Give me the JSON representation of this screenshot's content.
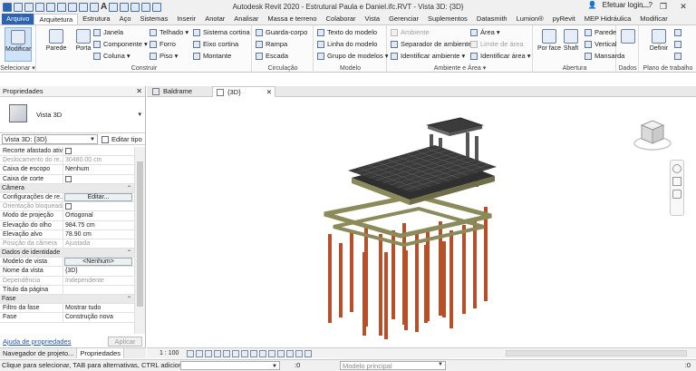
{
  "window": {
    "title": "Autodesk Revit 2020 - Estrutural Paula e Daniel.ifc.RVT - Vista 3D: {3D}",
    "login": "Efetuar login",
    "minimize": "—",
    "restore": "❐",
    "close": "✕"
  },
  "tabs": [
    "Arquivo",
    "Arquitetura",
    "Estrutura",
    "Aço",
    "Sistemas",
    "Inserir",
    "Anotar",
    "Analisar",
    "Massa e terreno",
    "Colaborar",
    "Vista",
    "Gerenciar",
    "Suplementos",
    "Datasmith",
    "Lumion®",
    "pyRevit",
    "MEP Hidráulica",
    "Modificar"
  ],
  "ribbon": {
    "selecionar": {
      "modificar": "Modificar",
      "label": "Selecionar ▾"
    },
    "construir": {
      "label": "Construir",
      "parede": "Parede",
      "porta": "Porta",
      "janela": "Janela",
      "componente": "Componente",
      "coluna": "Coluna",
      "telhado": "Telhado",
      "forro": "Forro",
      "piso": "Piso",
      "sistema_cortina": "Sistema cortina",
      "eixo_cortina": "Eixo cortina",
      "montante": "Montante"
    },
    "circulacao": {
      "label": "Circulação",
      "guarda_corpo": "Guarda-corpo",
      "rampa": "Rampa",
      "escada": "Escada"
    },
    "modelo": {
      "label": "Modelo",
      "texto": "Texto do modelo",
      "linha": "Linha do modelo",
      "grupo": "Grupo de modelos"
    },
    "ambiente": {
      "label": "Ambiente e Área ▾",
      "ambiente": "Ambiente",
      "separador": "Separador de ambiente",
      "identificar_ambiente": "Identificar ambiente",
      "area": "Área",
      "limite_area": "Limite de área",
      "identificar_area": "Identificar área"
    },
    "abertura": {
      "label": "Abertura",
      "por_face": "Por face",
      "shaft": "Shaft",
      "parede": "Parede",
      "vertical": "Vertical",
      "mansarda": "Mansarda"
    },
    "dados": {
      "label": "Dados"
    },
    "plano": {
      "label": "Plano de trabalho",
      "definir": "Definir"
    }
  },
  "properties": {
    "header": "Propriedades",
    "close": "✕",
    "type_name": "Vista 3D",
    "instance": "Vista 3D: {3D}",
    "edit_type": "Editar tipo",
    "rows": [
      {
        "k": "Recorte afastado ativo",
        "cb": true
      },
      {
        "k": "Deslocamento do re...",
        "v": "30480.00 cm",
        "dis": true
      },
      {
        "k": "Caixa de escopo",
        "v": "Nenhum"
      },
      {
        "k": "Caixa de corte",
        "cb": true
      },
      {
        "group": "Câmera"
      },
      {
        "k": "Configurações de re...",
        "btn": "Editar..."
      },
      {
        "k": "Orientação bloqueada",
        "cb": true,
        "dis": true
      },
      {
        "k": "Modo de projeção",
        "v": "Ortogonal"
      },
      {
        "k": "Elevação do olho",
        "v": "984.75 cm"
      },
      {
        "k": "Elevação alvo",
        "v": "78.90 cm"
      },
      {
        "k": "Posição da câmera",
        "v": "Ajustada",
        "dis": true
      },
      {
        "group": "Dados de identidade"
      },
      {
        "k": "Modelo de vista",
        "btn": "<Nenhum>"
      },
      {
        "k": "Nome da vista",
        "v": "{3D}"
      },
      {
        "k": "Dependência",
        "v": "Independente",
        "dis": true
      },
      {
        "k": "Título da página",
        "v": ""
      },
      {
        "group": "Fase"
      },
      {
        "k": "Filtro da fase",
        "v": "Mostrar tudo"
      },
      {
        "k": "Fase",
        "v": "Construção nova"
      }
    ],
    "help": "Ajuda de propriedades",
    "apply": "Aplicar"
  },
  "browser_tabs": [
    "Navegador de projeto...",
    "Propriedades"
  ],
  "view_tabs": [
    {
      "label": "Baldrame",
      "close": ""
    },
    {
      "label": "{3D}",
      "close": "✕"
    }
  ],
  "view_control": {
    "scale": "1 : 100"
  },
  "status": {
    "text": "Clique para selecionar, TAB para alternativas, CTRL adiciona, SHIFT desmarca.",
    "zero": ":0",
    "model": "Modelo principal",
    "filter": ":0"
  },
  "colors": {
    "accent": "#2a63b1",
    "column": "#b5502a",
    "beam_top": "#4a4a4a",
    "beam_side": "#8b8a5a",
    "slab": "#2f2f2f"
  }
}
